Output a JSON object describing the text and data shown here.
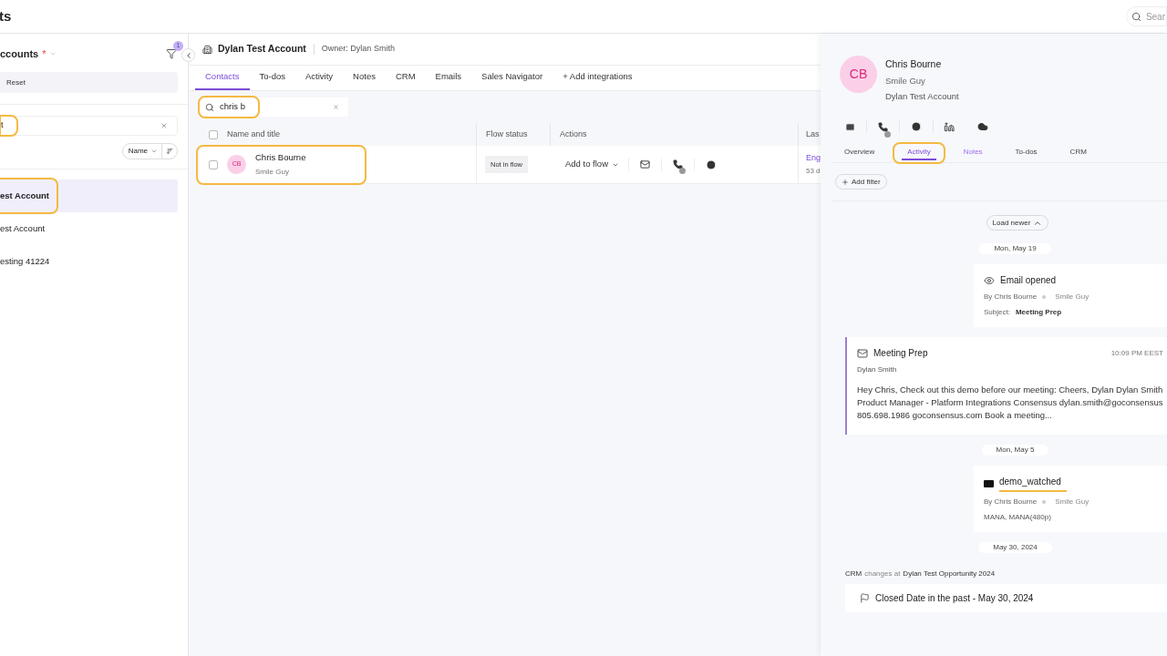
{
  "topbar": {
    "title": "ts",
    "search": {
      "placeholder": "Sear"
    }
  },
  "sidebar": {
    "title": "ccounts",
    "required_mark": "*",
    "filter_badge": "1",
    "reset": "Reset",
    "search": {
      "value": "t",
      "highlighted": true
    },
    "sort": {
      "label": "Name"
    },
    "items": [
      {
        "label": "est Account",
        "selected": true,
        "highlighted": true
      },
      {
        "label": "est Account",
        "selected": false,
        "highlighted": false
      },
      {
        "label": "esting 41224",
        "selected": false,
        "highlighted": false
      }
    ]
  },
  "account": {
    "name": "Dylan Test Account",
    "owner": "Owner: Dylan Smith"
  },
  "tabs": [
    {
      "label": "Contacts",
      "selected": true
    },
    {
      "label": "To-dos",
      "selected": false
    },
    {
      "label": "Activity",
      "selected": false
    },
    {
      "label": "Notes",
      "selected": false
    },
    {
      "label": "CRM",
      "selected": false
    },
    {
      "label": "Emails",
      "selected": false
    },
    {
      "label": "Sales Navigator",
      "selected": false
    },
    {
      "label": "+ Add integrations",
      "selected": false
    }
  ],
  "contact_search": {
    "value": "chris b",
    "highlighted": true
  },
  "table": {
    "select_all_checked": false,
    "columns": [
      "Name and title",
      "Flow status",
      "Actions",
      "Las"
    ],
    "rows": [
      {
        "checked": false,
        "initials": "CB",
        "name": "Chris Bourne",
        "title": "Smile Guy",
        "highlighted": true,
        "flow_status": "Not in flow",
        "flow_action": "Add to flow",
        "last": "Eng",
        "last_sub": "53 d"
      }
    ]
  },
  "contact_panel": {
    "initials": "CB",
    "name": "Chris Bourne",
    "title": "Smile Guy",
    "account": "Dylan Test Account",
    "tabs": [
      {
        "label": "Overview",
        "selected": false,
        "highlighted": false,
        "hovered": false
      },
      {
        "label": "Activity",
        "selected": true,
        "highlighted": true,
        "hovered": false
      },
      {
        "label": "Notes",
        "selected": false,
        "highlighted": false,
        "hovered": true
      },
      {
        "label": "To-dos",
        "selected": false,
        "highlighted": false,
        "hovered": false
      },
      {
        "label": "CRM",
        "selected": false,
        "highlighted": false,
        "hovered": false
      }
    ],
    "add_filter": "Add filter",
    "load_newer": "Load newer",
    "timeline": [
      {
        "kind": "date",
        "label": "Mon, May 19"
      },
      {
        "kind": "opened",
        "title": "Email opened",
        "by": "By Chris Bourne",
        "role": "Smile Guy",
        "detail_label": "Subject:",
        "detail": "Meeting Prep",
        "underlined": false
      },
      {
        "kind": "email",
        "title": "Meeting Prep",
        "time": "10:09 PM EEST",
        "sender": "Dylan Smith",
        "body": "Hey Chris, Check out this demo before our meeting: Cheers, Dylan Dylan Smith Product Manager - Platform Integrations Consensus dylan.smith@goconsensus 805.698.1986 goconsensus.com Book a meeting..."
      },
      {
        "kind": "date",
        "label": "Mon, May 5"
      },
      {
        "kind": "watched",
        "title": "demo_watched",
        "by": "By Chris Bourne",
        "role": "Smile Guy",
        "detail": "MANA, MANA(480p)",
        "underlined": true
      },
      {
        "kind": "date",
        "label": "May 30, 2024"
      },
      {
        "kind": "crm_note",
        "source": "CRM",
        "verb": "changes at",
        "target": "Dylan Test Opportunity 2024"
      },
      {
        "kind": "crm_change",
        "text": "Closed Date in the past - May 30, 2024"
      }
    ]
  }
}
